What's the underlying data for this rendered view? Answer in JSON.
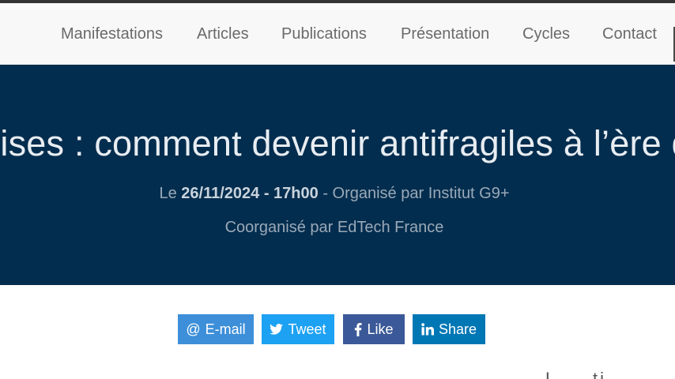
{
  "nav": {
    "items": [
      {
        "label": "Manifestations"
      },
      {
        "label": "Articles"
      },
      {
        "label": "Publications"
      },
      {
        "label": "Présentation"
      },
      {
        "label": "Cycles"
      },
      {
        "label": "Contact"
      }
    ]
  },
  "hero": {
    "title": "prises : comment devenir antifragiles à l’ère de",
    "date_prefix": "Le",
    "date_value": "26/11/2024 - 17h00",
    "organizer_text": "- Organisé par Institut G9+",
    "coorganizer_text": "Coorganisé par EdTech France"
  },
  "share": {
    "email_label": "E-mail",
    "email_icon": "@",
    "tweet_label": "Tweet",
    "like_label": "Like",
    "share_label": "Share"
  },
  "below": {
    "partial_text": "L  ...  ti"
  },
  "colors": {
    "hero_bg": "#032d4e",
    "email": "#3d8fd9",
    "twitter": "#1da1f2",
    "facebook": "#3b5998",
    "linkedin": "#0077b5"
  }
}
